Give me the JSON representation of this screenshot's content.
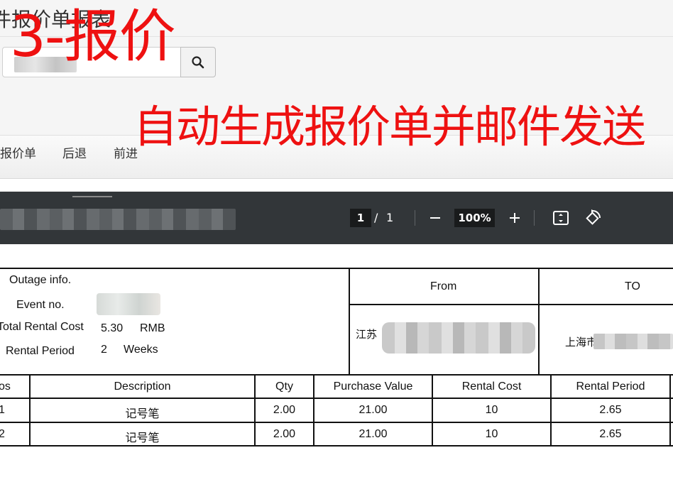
{
  "app": {
    "title": "件报价单报表",
    "search_icon": "search-icon",
    "toolbar": {
      "links": [
        "报价单",
        "后退",
        "前进"
      ]
    }
  },
  "overlay": {
    "title": "3-报价",
    "subtitle": "自动生成报价单并邮件发送",
    "color": "#ee1111"
  },
  "pdf_viewer": {
    "current_page": "1",
    "separator": "/",
    "total_pages": "1",
    "zoom": "100%",
    "icons": [
      "zoom-out-icon",
      "zoom-in-icon",
      "fit-page-icon",
      "rotate-icon"
    ]
  },
  "document": {
    "info": {
      "outage_label": "Outage info.",
      "event_label": "Event no.",
      "cost_label": "Total Rental Cost",
      "cost_value": "5.30",
      "cost_unit": "RMB",
      "period_label": "Rental Period",
      "period_value": "2",
      "period_unit": "Weeks"
    },
    "from_label": "From",
    "to_label": "TO",
    "from_address": "江苏",
    "to_address": "上海市",
    "table": {
      "headers": [
        "os",
        "Description",
        "Qty",
        "Purchase Value",
        "Rental Cost",
        "Rental Period"
      ],
      "rows": [
        {
          "pos": "1",
          "description": "记号笔",
          "qty": "2.00",
          "purchase_value": "21.00",
          "rental_cost": "10",
          "rental_period": "2.65"
        },
        {
          "pos": "2",
          "description": "记号笔",
          "qty": "2.00",
          "purchase_value": "21.00",
          "rental_cost": "10",
          "rental_period": "2.65"
        }
      ]
    }
  }
}
